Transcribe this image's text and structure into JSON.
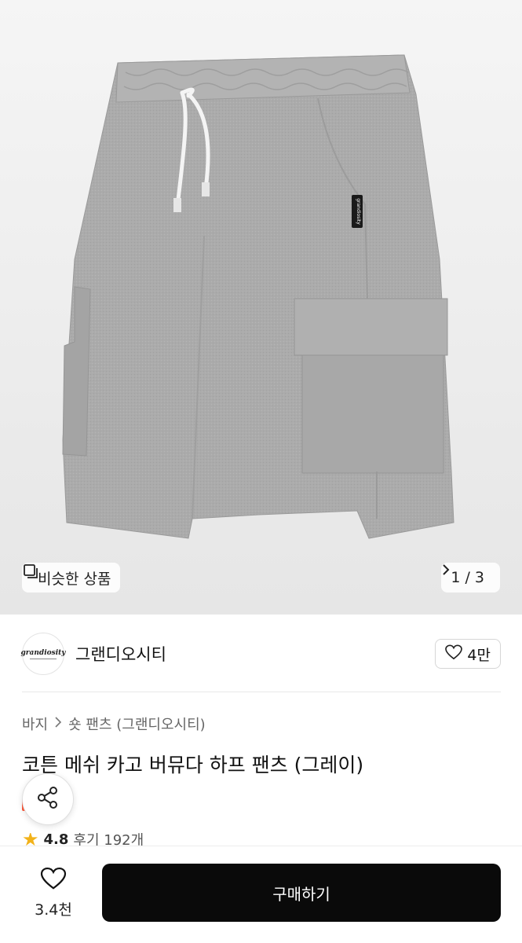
{
  "hero": {
    "similar_label": "비슷한 상품",
    "counter": "1 / 3",
    "tag_text": "grandiosity"
  },
  "brand": {
    "logo_text": "grandiosity",
    "name": "그랜디오시티",
    "like_count": "4만"
  },
  "breadcrumb": {
    "category": "바지",
    "subcategory": "숏 팬츠 (그랜디오시티)"
  },
  "product": {
    "title": "코튼 메쉬 카고 버뮤다 하프 팬츠 (그레이)"
  },
  "rating": {
    "score": "4.8",
    "reviews": "후기 192개"
  },
  "bottom": {
    "wish_count": "3.4천",
    "buy_label": "구매하기"
  },
  "colors": {
    "buy_button": "#0a0a0a",
    "star": "#f2b21a",
    "pants": "#a9a9a9"
  },
  "icons": [
    "similar-items-icon",
    "chevron-right-icon",
    "heart-outline-icon",
    "share-icon",
    "star-icon"
  ]
}
